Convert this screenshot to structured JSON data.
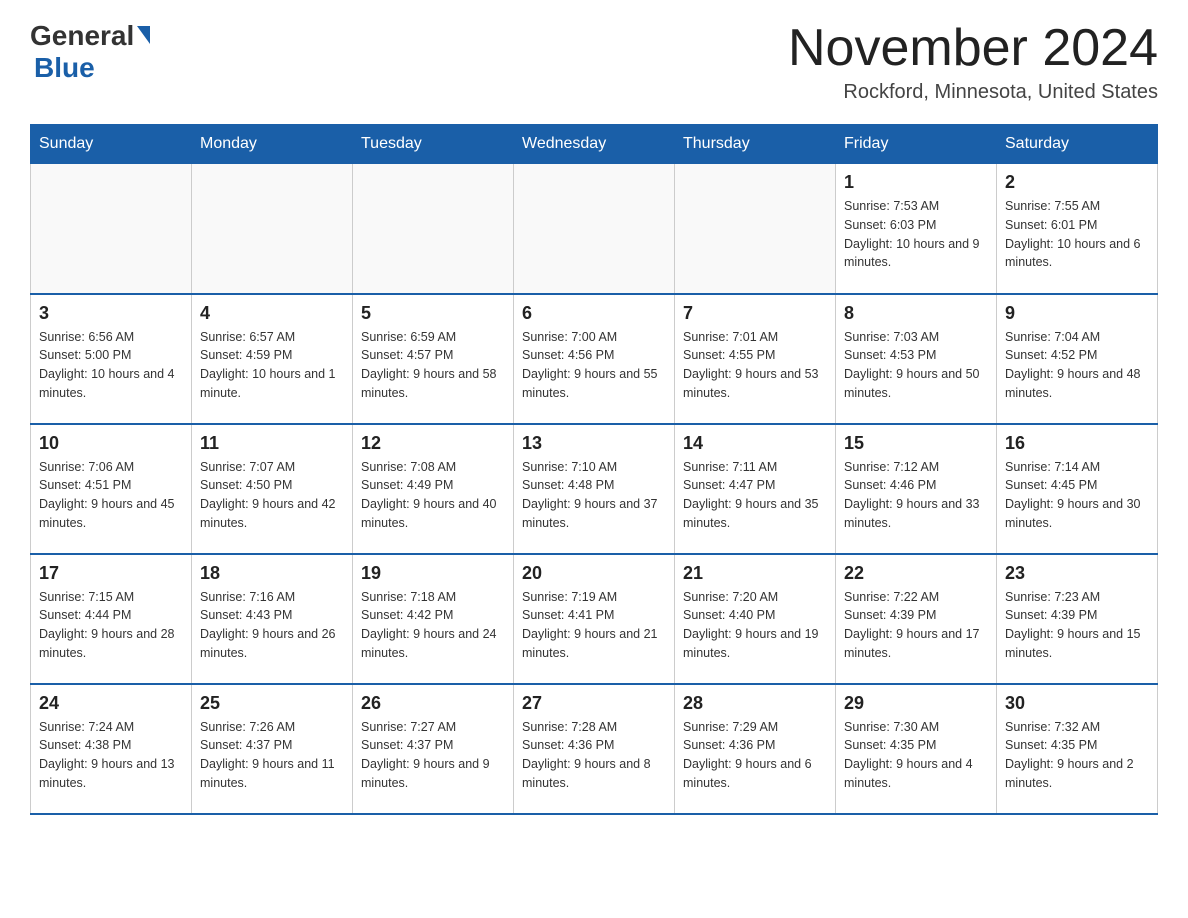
{
  "header": {
    "logo_general": "General",
    "logo_blue": "Blue",
    "month": "November 2024",
    "location": "Rockford, Minnesota, United States"
  },
  "weekdays": [
    "Sunday",
    "Monday",
    "Tuesday",
    "Wednesday",
    "Thursday",
    "Friday",
    "Saturday"
  ],
  "weeks": [
    [
      {
        "day": "",
        "info": ""
      },
      {
        "day": "",
        "info": ""
      },
      {
        "day": "",
        "info": ""
      },
      {
        "day": "",
        "info": ""
      },
      {
        "day": "",
        "info": ""
      },
      {
        "day": "1",
        "info": "Sunrise: 7:53 AM\nSunset: 6:03 PM\nDaylight: 10 hours and 9 minutes."
      },
      {
        "day": "2",
        "info": "Sunrise: 7:55 AM\nSunset: 6:01 PM\nDaylight: 10 hours and 6 minutes."
      }
    ],
    [
      {
        "day": "3",
        "info": "Sunrise: 6:56 AM\nSunset: 5:00 PM\nDaylight: 10 hours and 4 minutes."
      },
      {
        "day": "4",
        "info": "Sunrise: 6:57 AM\nSunset: 4:59 PM\nDaylight: 10 hours and 1 minute."
      },
      {
        "day": "5",
        "info": "Sunrise: 6:59 AM\nSunset: 4:57 PM\nDaylight: 9 hours and 58 minutes."
      },
      {
        "day": "6",
        "info": "Sunrise: 7:00 AM\nSunset: 4:56 PM\nDaylight: 9 hours and 55 minutes."
      },
      {
        "day": "7",
        "info": "Sunrise: 7:01 AM\nSunset: 4:55 PM\nDaylight: 9 hours and 53 minutes."
      },
      {
        "day": "8",
        "info": "Sunrise: 7:03 AM\nSunset: 4:53 PM\nDaylight: 9 hours and 50 minutes."
      },
      {
        "day": "9",
        "info": "Sunrise: 7:04 AM\nSunset: 4:52 PM\nDaylight: 9 hours and 48 minutes."
      }
    ],
    [
      {
        "day": "10",
        "info": "Sunrise: 7:06 AM\nSunset: 4:51 PM\nDaylight: 9 hours and 45 minutes."
      },
      {
        "day": "11",
        "info": "Sunrise: 7:07 AM\nSunset: 4:50 PM\nDaylight: 9 hours and 42 minutes."
      },
      {
        "day": "12",
        "info": "Sunrise: 7:08 AM\nSunset: 4:49 PM\nDaylight: 9 hours and 40 minutes."
      },
      {
        "day": "13",
        "info": "Sunrise: 7:10 AM\nSunset: 4:48 PM\nDaylight: 9 hours and 37 minutes."
      },
      {
        "day": "14",
        "info": "Sunrise: 7:11 AM\nSunset: 4:47 PM\nDaylight: 9 hours and 35 minutes."
      },
      {
        "day": "15",
        "info": "Sunrise: 7:12 AM\nSunset: 4:46 PM\nDaylight: 9 hours and 33 minutes."
      },
      {
        "day": "16",
        "info": "Sunrise: 7:14 AM\nSunset: 4:45 PM\nDaylight: 9 hours and 30 minutes."
      }
    ],
    [
      {
        "day": "17",
        "info": "Sunrise: 7:15 AM\nSunset: 4:44 PM\nDaylight: 9 hours and 28 minutes."
      },
      {
        "day": "18",
        "info": "Sunrise: 7:16 AM\nSunset: 4:43 PM\nDaylight: 9 hours and 26 minutes."
      },
      {
        "day": "19",
        "info": "Sunrise: 7:18 AM\nSunset: 4:42 PM\nDaylight: 9 hours and 24 minutes."
      },
      {
        "day": "20",
        "info": "Sunrise: 7:19 AM\nSunset: 4:41 PM\nDaylight: 9 hours and 21 minutes."
      },
      {
        "day": "21",
        "info": "Sunrise: 7:20 AM\nSunset: 4:40 PM\nDaylight: 9 hours and 19 minutes."
      },
      {
        "day": "22",
        "info": "Sunrise: 7:22 AM\nSunset: 4:39 PM\nDaylight: 9 hours and 17 minutes."
      },
      {
        "day": "23",
        "info": "Sunrise: 7:23 AM\nSunset: 4:39 PM\nDaylight: 9 hours and 15 minutes."
      }
    ],
    [
      {
        "day": "24",
        "info": "Sunrise: 7:24 AM\nSunset: 4:38 PM\nDaylight: 9 hours and 13 minutes."
      },
      {
        "day": "25",
        "info": "Sunrise: 7:26 AM\nSunset: 4:37 PM\nDaylight: 9 hours and 11 minutes."
      },
      {
        "day": "26",
        "info": "Sunrise: 7:27 AM\nSunset: 4:37 PM\nDaylight: 9 hours and 9 minutes."
      },
      {
        "day": "27",
        "info": "Sunrise: 7:28 AM\nSunset: 4:36 PM\nDaylight: 9 hours and 8 minutes."
      },
      {
        "day": "28",
        "info": "Sunrise: 7:29 AM\nSunset: 4:36 PM\nDaylight: 9 hours and 6 minutes."
      },
      {
        "day": "29",
        "info": "Sunrise: 7:30 AM\nSunset: 4:35 PM\nDaylight: 9 hours and 4 minutes."
      },
      {
        "day": "30",
        "info": "Sunrise: 7:32 AM\nSunset: 4:35 PM\nDaylight: 9 hours and 2 minutes."
      }
    ]
  ]
}
